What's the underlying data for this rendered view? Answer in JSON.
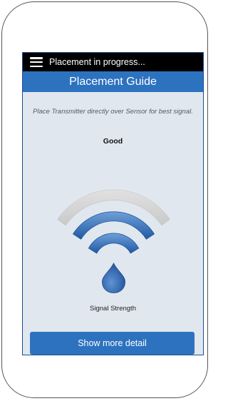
{
  "status_bar": {
    "icon": "hamburger-menu-icon",
    "text": "Placement in progress..."
  },
  "header": {
    "title": "Placement Guide"
  },
  "main": {
    "instruction": "Place Transmitter directly over Sensor for best signal.",
    "signal_quality": "Good",
    "signal_label": "Signal Strength",
    "signal_bars_total": 3,
    "signal_bars_active": 2,
    "signal_icon": "wifi-signal-icon",
    "drop_icon": "sensor-drop-icon",
    "colors": {
      "active_arc": "#2f6db8",
      "inactive_arc": "#d4d4d4",
      "primary": "#2d72bf"
    }
  },
  "footer": {
    "button_label": "Show more detail"
  }
}
